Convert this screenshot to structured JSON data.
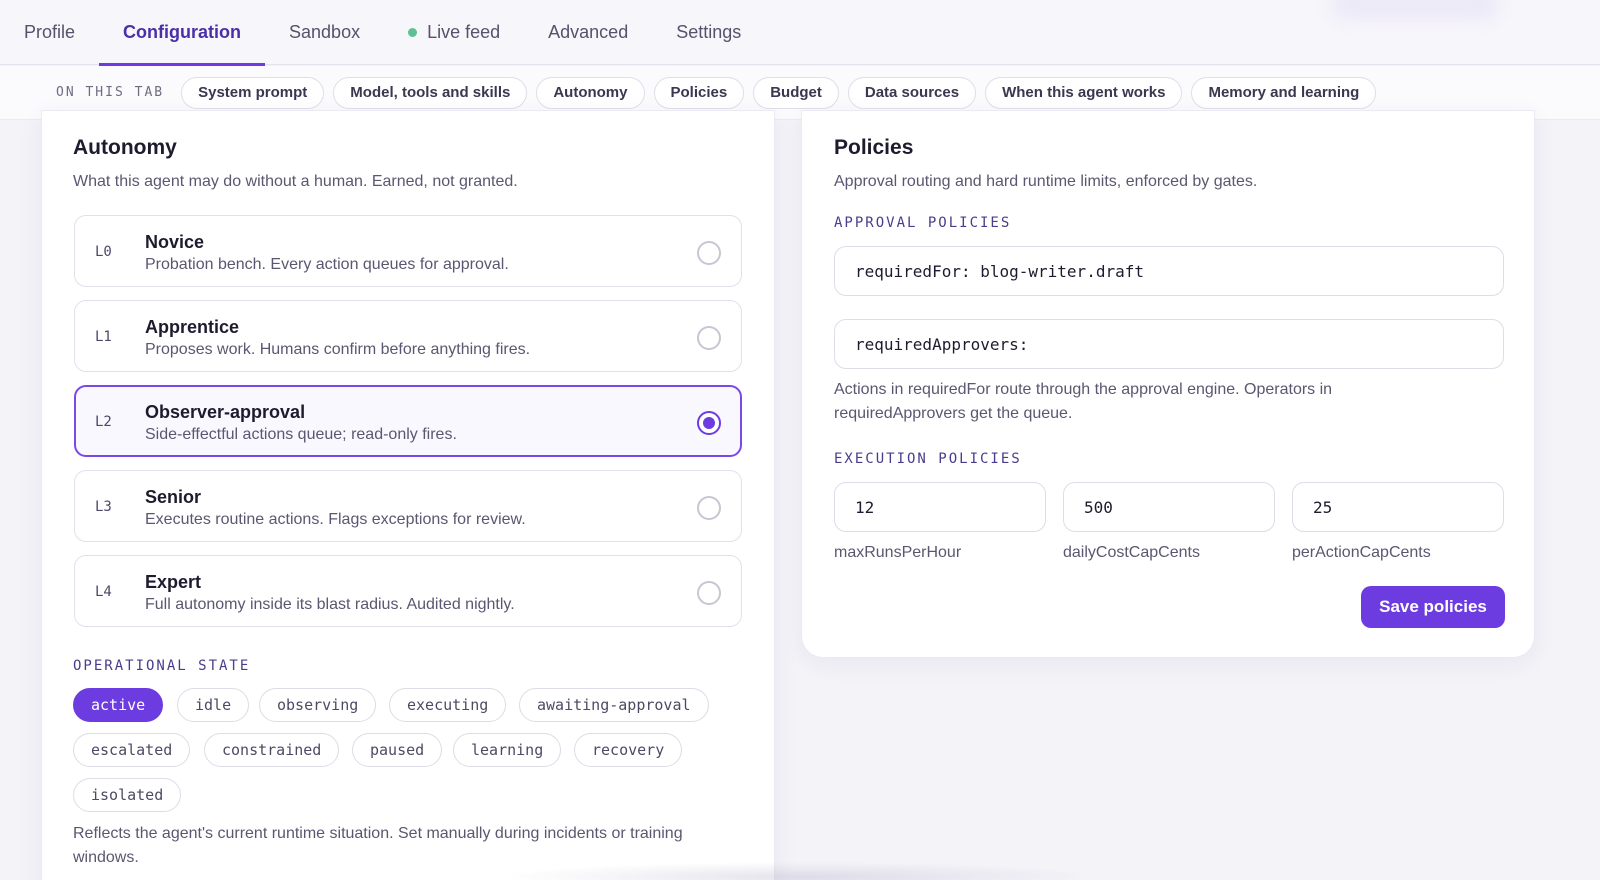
{
  "tabs": [
    {
      "label": "Profile",
      "active": false
    },
    {
      "label": "Configuration",
      "active": true
    },
    {
      "label": "Sandbox",
      "active": false
    },
    {
      "label": "Live feed",
      "active": false,
      "live": true
    },
    {
      "label": "Advanced",
      "active": false
    },
    {
      "label": "Settings",
      "active": false
    }
  ],
  "subnav": {
    "label": "ON THIS TAB",
    "chips": [
      "System prompt",
      "Model, tools and skills",
      "Autonomy",
      "Policies",
      "Budget",
      "Data sources",
      "When this agent works",
      "Memory and learning"
    ]
  },
  "autonomy": {
    "title": "Autonomy",
    "description": "What this agent may do without a human. Earned, not granted.",
    "levels": [
      {
        "code": "L0",
        "name": "Novice",
        "desc": "Probation bench. Every action queues for approval.",
        "selected": false
      },
      {
        "code": "L1",
        "name": "Apprentice",
        "desc": "Proposes work. Humans confirm before anything fires.",
        "selected": false
      },
      {
        "code": "L2",
        "name": "Observer-approval",
        "desc": "Side-effectful actions queue; read-only fires.",
        "selected": true
      },
      {
        "code": "L3",
        "name": "Senior",
        "desc": "Executes routine actions. Flags exceptions for review.",
        "selected": false
      },
      {
        "code": "L4",
        "name": "Expert",
        "desc": "Full autonomy inside its blast radius. Audited nightly.",
        "selected": false
      }
    ],
    "operational_state_label": "OPERATIONAL STATE",
    "states": [
      "active",
      "idle",
      "observing",
      "executing",
      "awaiting-approval",
      "escalated",
      "constrained",
      "paused",
      "learning",
      "recovery",
      "isolated"
    ],
    "active_state": "active",
    "state_note_line1": "Reflects the agent's current runtime situation. Set manually during incidents or training",
    "state_note_line2": "windows."
  },
  "policies": {
    "title": "Policies",
    "description": "Approval routing and hard runtime limits, enforced by gates.",
    "approval_label": "APPROVAL POLICIES",
    "required_for": "requiredFor: blog-writer.draft",
    "required_approvers": "requiredApprovers:",
    "approval_note_line1": "Actions in requiredFor route through the approval engine. Operators in",
    "approval_note_line2": "requiredApprovers get the queue.",
    "execution_label": "EXECUTION POLICIES",
    "execution": [
      {
        "value": "12",
        "caption": "maxRunsPerHour"
      },
      {
        "value": "500",
        "caption": "dailyCostCapCents"
      },
      {
        "value": "25",
        "caption": "perActionCapCents"
      }
    ],
    "save_label": "Save policies"
  },
  "colors": {
    "accent": "#6d3ce0",
    "live": "#5fbf95"
  }
}
